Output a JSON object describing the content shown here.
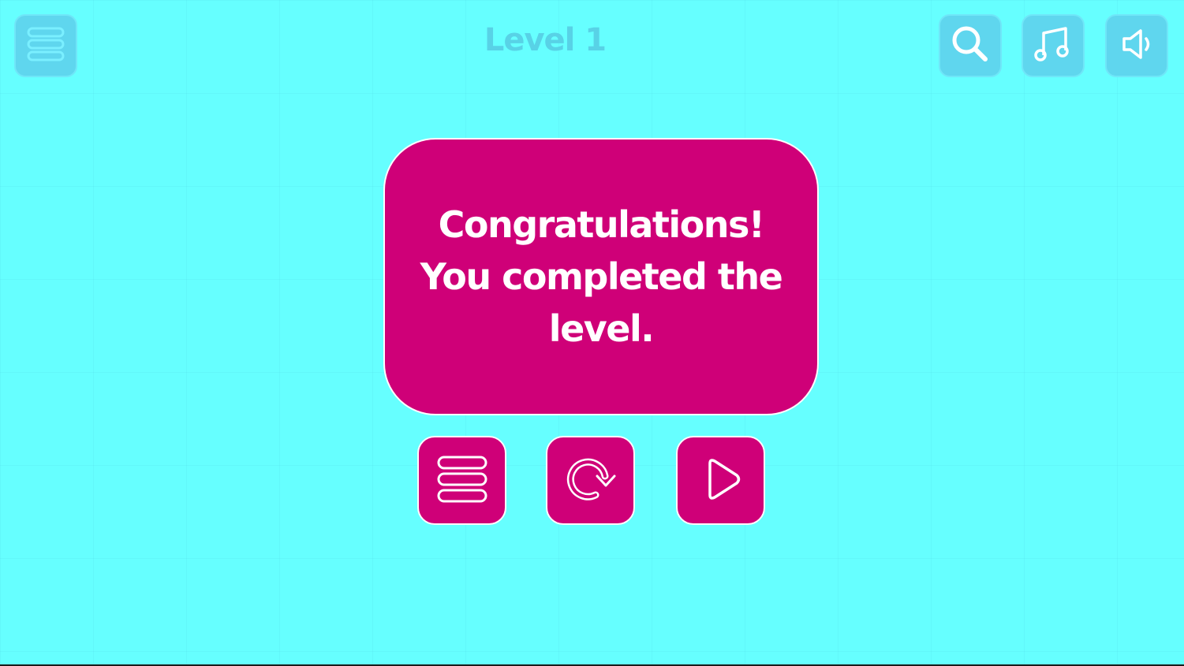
{
  "header": {
    "level_title": "Level 1",
    "icons": [
      "menu-icon",
      "search-icon",
      "music-icon",
      "sound-icon"
    ]
  },
  "dialog": {
    "message": "Congratulations! You completed the level."
  },
  "actions": {
    "icons": [
      "menu-icon",
      "restart-icon",
      "play-next-icon"
    ]
  },
  "colors": {
    "background": "#66ffff",
    "panel": "#cf0078",
    "top_buttons": "#5fd6ee",
    "text": "#ffffff"
  }
}
